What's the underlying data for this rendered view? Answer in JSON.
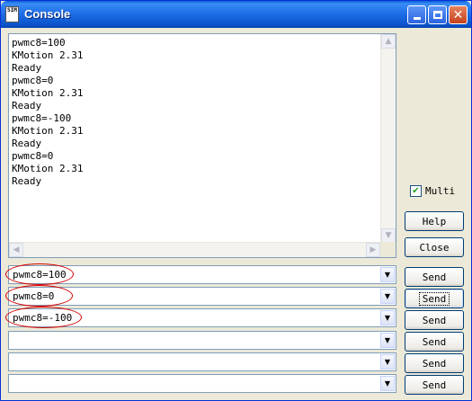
{
  "window": {
    "title": "Console",
    "app_icon_text": "SIM"
  },
  "output": {
    "text": "pwmc8=100\nKMotion 2.31\nReady\npwmc8=0\nKMotion 2.31\nReady\npwmc8=-100\nKMotion 2.31\nReady\npwmc8=0\nKMotion 2.31\nReady"
  },
  "scroll": {
    "up": "▲",
    "down": "▼",
    "left": "◀",
    "right": "▶"
  },
  "commands": [
    {
      "value": "pwmc8=100"
    },
    {
      "value": "pwmc8=0"
    },
    {
      "value": "pwmc8=-100"
    },
    {
      "value": ""
    },
    {
      "value": ""
    },
    {
      "value": ""
    }
  ],
  "combo_arrow": "▼",
  "buttons": {
    "send": "Send",
    "help": "Help",
    "close": "Close"
  },
  "multi": {
    "label": "Multi",
    "checked": true,
    "check_mark": "✔"
  },
  "titlebar_buttons": {
    "close_glyph": "✕"
  }
}
